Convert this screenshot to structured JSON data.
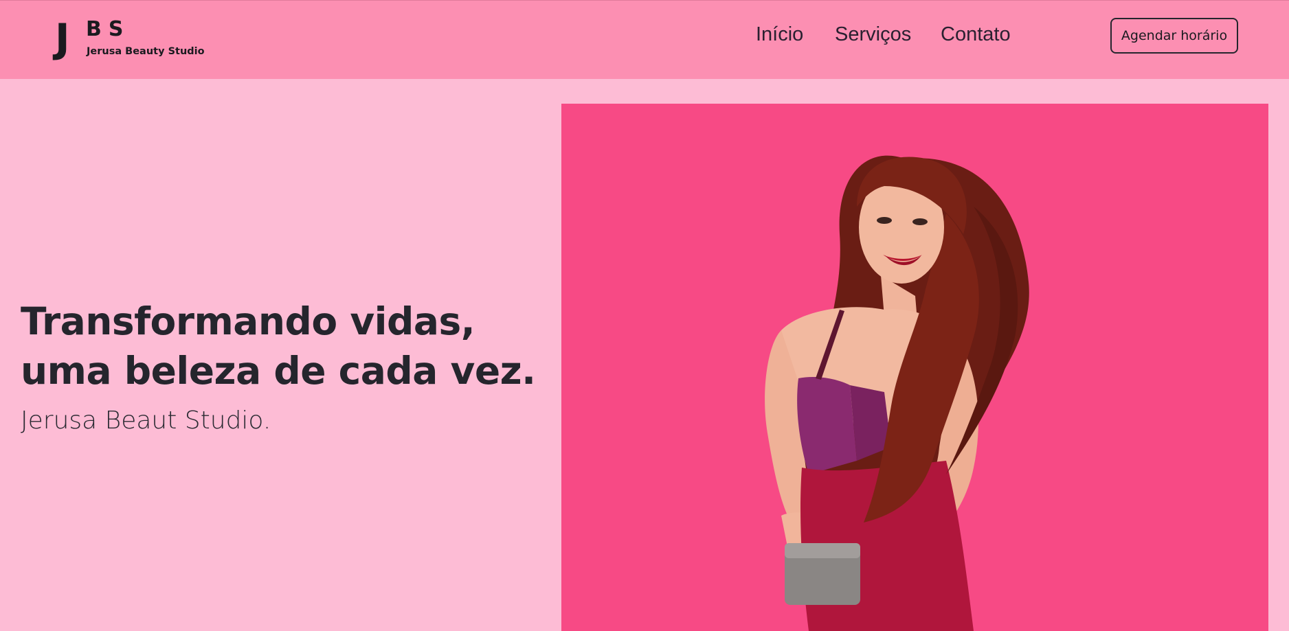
{
  "header": {
    "logo": {
      "mark_j": "J",
      "mark_bs": "BS",
      "name": "Jerusa Beauty Studio"
    },
    "nav": {
      "items": [
        {
          "label": "Início"
        },
        {
          "label": "Serviços"
        },
        {
          "label": "Contato"
        }
      ]
    },
    "cta_label": "Agendar horário"
  },
  "hero": {
    "title_line1": "Transformando vidas,",
    "title_line2": "uma beleza de cada vez.",
    "subtitle": "Jerusa Beaut Studio."
  },
  "colors": {
    "header_bg": "#fc8fb2",
    "page_bg": "#fdbcd5",
    "image_bg": "#f74a85",
    "text": "#25252d"
  }
}
